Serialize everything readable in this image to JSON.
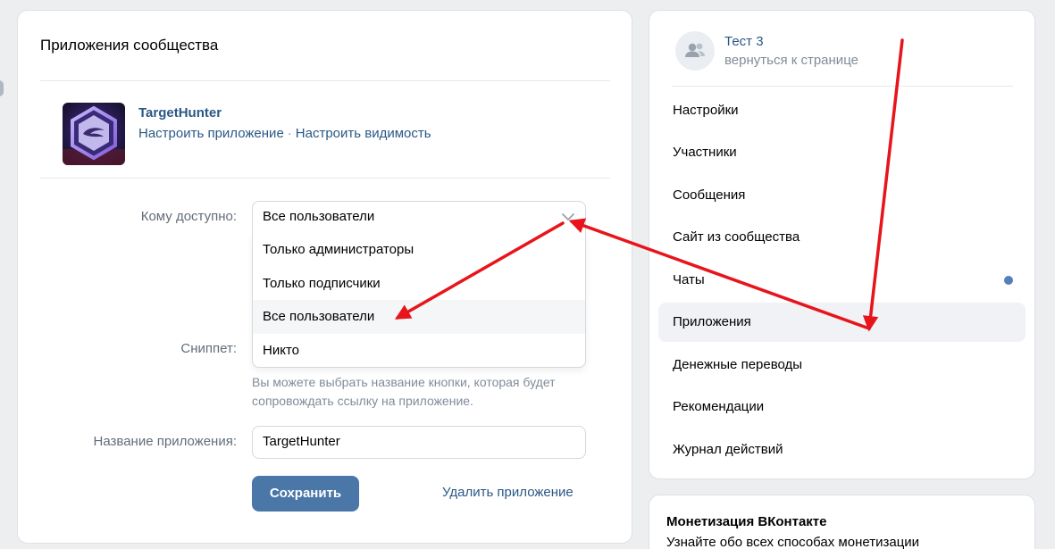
{
  "main": {
    "title": "Приложения сообщества",
    "app": {
      "name": "TargetHunter",
      "configure_link": "Настроить приложение",
      "separator": "·",
      "visibility_link": "Настроить видимость"
    },
    "form": {
      "access_label": "Кому доступно:",
      "access_value": "Все пользователи",
      "access_options": [
        "Только администраторы",
        "Только подписчики",
        "Все пользователи",
        "Никто"
      ],
      "snippet_label": "Сниппет:",
      "snippet_hint": "Вы можете выбрать название кнопки, которая будет сопровождать ссылку на приложение.",
      "app_name_label": "Название приложения:",
      "app_name_value": "TargetHunter",
      "save_button": "Сохранить",
      "delete_link": "Удалить приложение"
    }
  },
  "sidebar": {
    "group_name": "Тест 3",
    "back_link": "вернуться к странице",
    "items": [
      {
        "label": "Настройки"
      },
      {
        "label": "Участники"
      },
      {
        "label": "Сообщения"
      },
      {
        "label": "Сайт из сообщества"
      },
      {
        "label": "Чаты"
      },
      {
        "label": "Приложения"
      },
      {
        "label": "Денежные переводы"
      },
      {
        "label": "Рекомендации"
      },
      {
        "label": "Журнал действий"
      }
    ],
    "active_item": "Приложения"
  },
  "promo": {
    "title": "Монетизация ВКонтакте",
    "text": "Узнайте обо всех способах монетизации"
  },
  "colors": {
    "link": "#2a5885",
    "button": "#4a76a8",
    "annotation_arrow": "#e8141b",
    "unread_dot": "#5181b8"
  },
  "icons": {
    "group_avatar": "users-icon",
    "select_arrow": "chevron-down-icon"
  }
}
